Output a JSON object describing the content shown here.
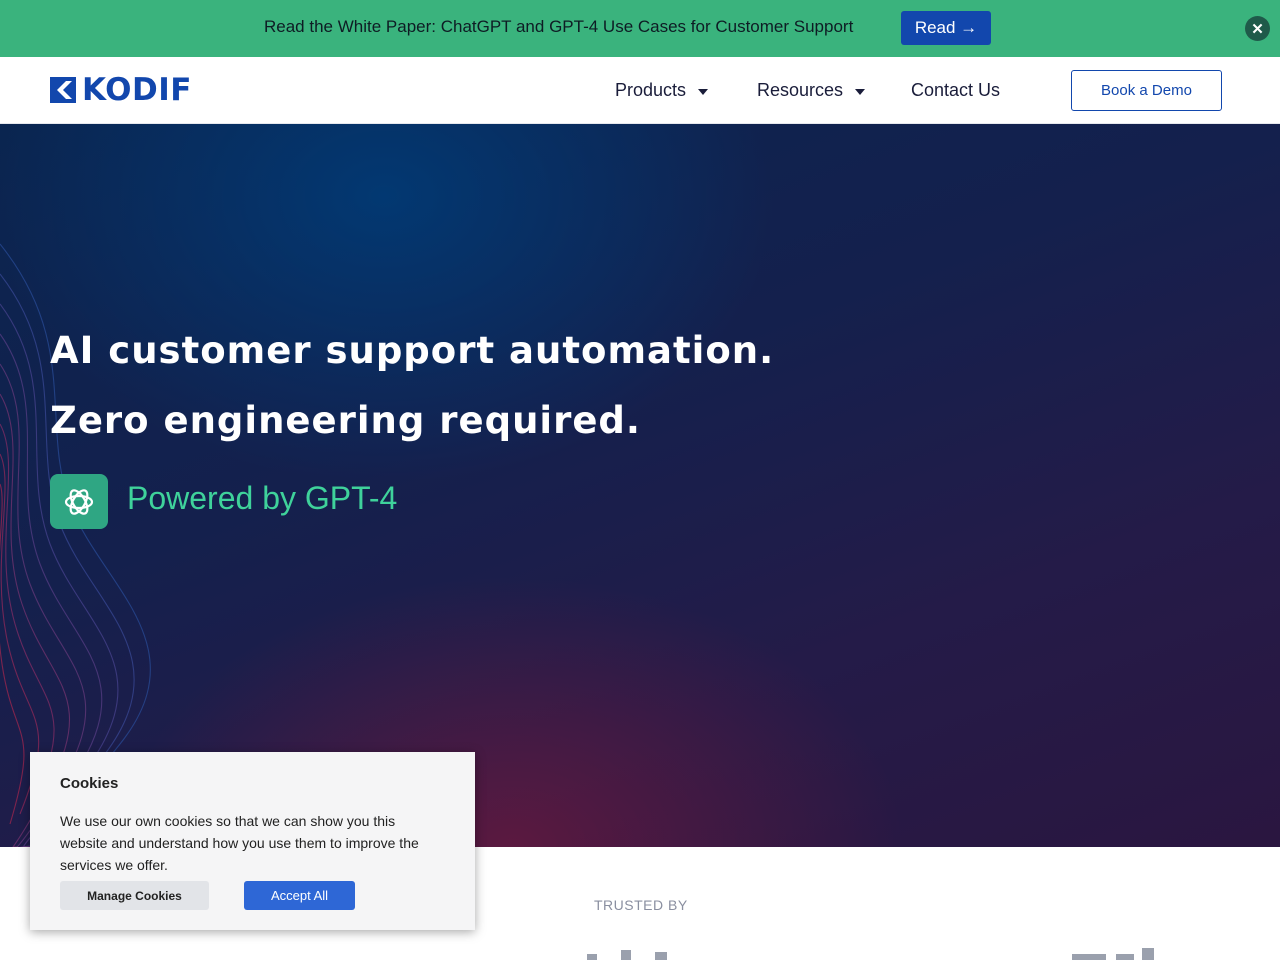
{
  "announcement": {
    "text": "Read the White Paper: ChatGPT and GPT-4 Use Cases for Customer Support",
    "button_label": "Read →",
    "close_label": "✕"
  },
  "header": {
    "logo_text": "KODIF",
    "nav": [
      {
        "label": "Products",
        "has_dropdown": true
      },
      {
        "label": "Resources",
        "has_dropdown": true
      },
      {
        "label": "Contact Us",
        "has_dropdown": false
      }
    ],
    "cta_label": "Book a Demo"
  },
  "hero": {
    "headline_1": "AI customer support automation.",
    "headline_2": "Zero engineering required.",
    "powered_by": "Powered by GPT-4",
    "badge_icon": "openai-icon"
  },
  "trusted": {
    "label": "TRUSTED BY"
  },
  "cookie_banner": {
    "title": "Cookies",
    "body": "We use our own cookies so that we can show you this website and understand how you use them to improve the services we offer.",
    "manage_label": "Manage Cookies",
    "accept_label": "Accept All"
  },
  "colors": {
    "announcement_bg": "#3ab37d",
    "brand_blue": "#1247ad",
    "gpt_green": "#3fd29b",
    "accept_blue": "#2e67d6"
  }
}
